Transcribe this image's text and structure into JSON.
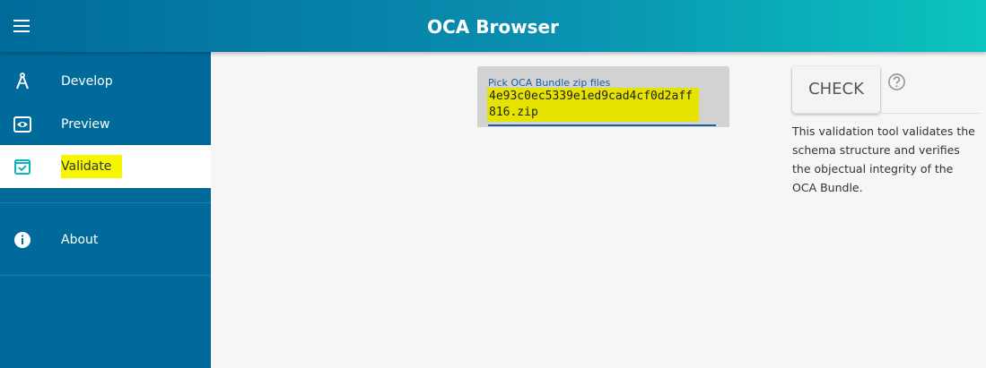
{
  "app": {
    "title": "OCA Browser"
  },
  "sidebar": {
    "items": [
      {
        "label": "Develop",
        "icon": "compass-icon",
        "active": false
      },
      {
        "label": "Preview",
        "icon": "eye-icon",
        "active": false
      },
      {
        "label": "Validate",
        "icon": "check-box-icon",
        "active": true
      },
      {
        "label": "About",
        "icon": "info-icon",
        "active": false
      }
    ]
  },
  "file_picker": {
    "label": "Pick OCA Bundle zip files",
    "value": "4e93c0ec5339e1ed9cad4cf0d2aff816.zip"
  },
  "check": {
    "label": "CHECK",
    "help_icon": "help-circle-icon"
  },
  "info": {
    "text": "This validation tool validates the schema structure and verifies the objectual integrity of the OCA Bundle."
  },
  "colors": {
    "sidebar_bg": "#006b9a",
    "appbar_start": "#006b9a",
    "appbar_end": "#0bc4bf",
    "highlight": "#f6f600",
    "accent": "#1a5fa0"
  }
}
